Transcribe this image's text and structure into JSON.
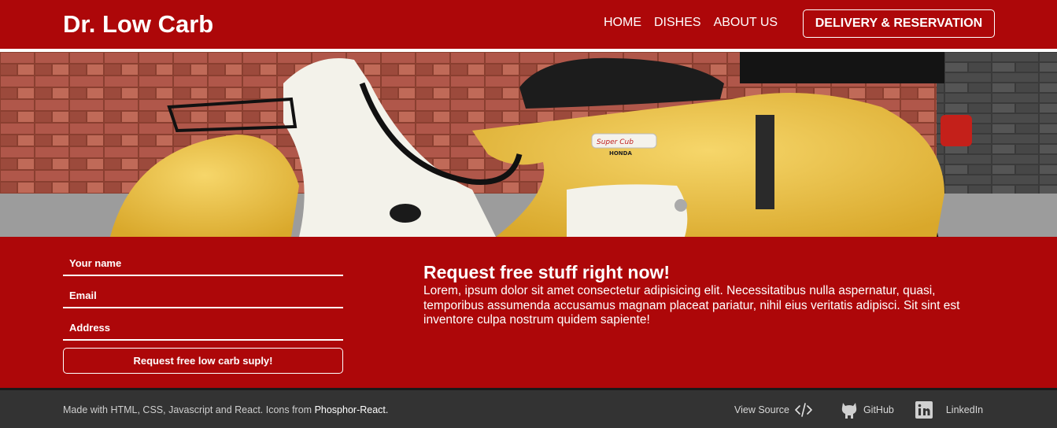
{
  "header": {
    "brand": "Dr. Low Carb",
    "nav": [
      "HOME",
      "DISHES",
      "ABOUT US"
    ],
    "cta_label": "DELIVERY & RESERVATION"
  },
  "form": {
    "name_placeholder": "Your name",
    "email_placeholder": "Email",
    "address_placeholder": "Address",
    "submit_label": "Request free low carb suply!"
  },
  "promo": {
    "title": "Request free stuff right now!",
    "body": "Lorem, ipsum dolor sit amet consectetur adipisicing elit. Necessitatibus nulla aspernatur, quasi, temporibus assumenda accusamus magnam placeat pariatur, nihil eius veritatis adipisci. Sit sint est inventore culpa nostrum quidem sapiente!"
  },
  "hero": {
    "badge_brand": "Super Cub",
    "badge_maker": "HONDA"
  },
  "footer": {
    "made_with": "Made with HTML, CSS, Javascript and React. Icons from ",
    "icons_link": "Phosphor-React.",
    "links": {
      "view_source": "View Source",
      "github": "GitHub",
      "linkedin": "LinkedIn"
    }
  },
  "colors": {
    "primary": "#ad0709",
    "footer_bg": "#333333"
  }
}
